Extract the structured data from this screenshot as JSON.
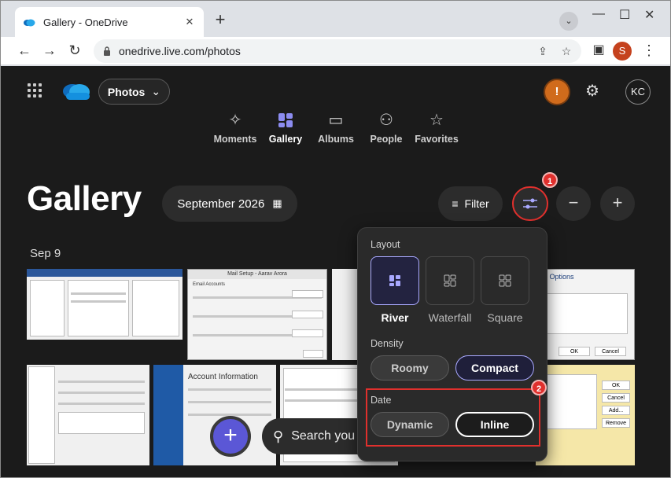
{
  "browser": {
    "tab_title": "Gallery - OneDrive",
    "tab_close": "✕",
    "new_tab": "+",
    "url": "onedrive.live.com/photos",
    "profile_initial": "S",
    "controls": {
      "minimize": "—",
      "maximize": "☐",
      "close": "✕"
    }
  },
  "app": {
    "product_switcher": "Photos",
    "account_initials": "KC",
    "warning_glyph": "!",
    "nav": [
      {
        "label": "Moments",
        "icon": "sparkle-icon"
      },
      {
        "label": "Gallery",
        "icon": "grid-icon"
      },
      {
        "label": "Albums",
        "icon": "album-icon"
      },
      {
        "label": "People",
        "icon": "people-icon"
      },
      {
        "label": "Favorites",
        "icon": "star-icon"
      }
    ]
  },
  "gallery": {
    "title": "Gallery",
    "date_selector": "September 2026",
    "filter_label": "Filter",
    "date_group": "Sep 9",
    "search_placeholder": "Search you"
  },
  "view_options": {
    "layout_heading": "Layout",
    "layouts": [
      "River",
      "Waterfall",
      "Square"
    ],
    "selected_layout": "River",
    "density_heading": "Density",
    "densities": [
      "Roomy",
      "Compact"
    ],
    "selected_density": "Compact",
    "date_heading": "Date",
    "dates": [
      "Dynamic",
      "Inline"
    ],
    "selected_date": "Inline"
  },
  "annotations": {
    "callout_1": "1",
    "callout_2": "2",
    "accent": "#e0302d"
  },
  "thumb_text": {
    "mail_setup": "Mail Setup - Aarav Arora",
    "email_accounts": "Email Accounts",
    "account_information": "Account Information",
    "options": "ng Options",
    "ok": "OK",
    "cancel": "Cancel",
    "add": "Add...",
    "remove": "Remove"
  }
}
